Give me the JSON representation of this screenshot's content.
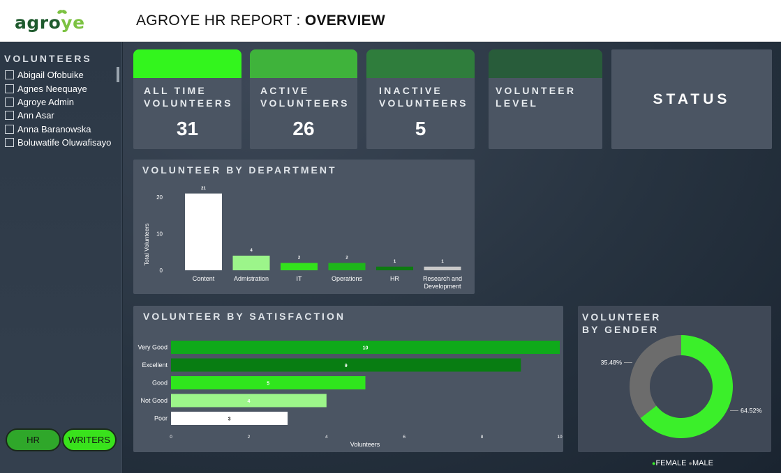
{
  "header": {
    "logo_main": "agro",
    "logo_accent": "ye",
    "title_prefix": "AGROYE HR REPORT : ",
    "title_bold": "OVERVIEW"
  },
  "sidebar": {
    "title": "VOLUNTEERS",
    "items": [
      {
        "label": "Abigail Ofobuike"
      },
      {
        "label": "Agnes Neequaye"
      },
      {
        "label": "Agroye Admin"
      },
      {
        "label": "Ann Asar"
      },
      {
        "label": "Anna Baranowska"
      },
      {
        "label": "Boluwatife Oluwafisayo"
      }
    ],
    "buttons": {
      "hr": "HR",
      "writers": "WRITERS"
    }
  },
  "kpis": {
    "all_time": {
      "line1": "ALL TIME",
      "line2": "VOLUNTEERS",
      "value": "31",
      "color": "#33f51d"
    },
    "active": {
      "line1": "ACTIVE",
      "line2": "VOLUNTEERS",
      "value": "26",
      "color": "#3fb33b"
    },
    "inactive": {
      "line1": "INACTIVE",
      "line2": "VOLUNTEERS",
      "value": "5",
      "color": "#2f7d3c"
    },
    "level": {
      "line1": "VOLUNTEER",
      "line2": "LEVEL",
      "color": "#285c3a"
    }
  },
  "status_label": "STATUS",
  "panels": {
    "department_title": "VOLUNTEER BY DEPARTMENT",
    "satisfaction_title": "VOLUNTEER BY SATISFACTION",
    "gender_title_line1": "VOLUNTEER",
    "gender_title_line2": "BY GENDER"
  },
  "legend": {
    "female": "FEMALE",
    "male": "MALE"
  },
  "chart_data": [
    {
      "type": "bar",
      "title": "VOLUNTEER BY DEPARTMENT",
      "ylabel": "Total Volunteers",
      "categories": [
        "Content",
        "Admistration",
        "IT",
        "Operations",
        "HR",
        "Research and Development"
      ],
      "values": [
        21,
        4,
        2,
        2,
        1,
        1
      ],
      "colors": [
        "#ffffff",
        "#9cf58a",
        "#33e21c",
        "#1eb61a",
        "#0e7a12",
        "#c9c9c9"
      ],
      "yticks": [
        0,
        10,
        20
      ],
      "ylim": [
        0,
        21
      ]
    },
    {
      "type": "bar",
      "orientation": "horizontal",
      "title": "VOLUNTEER BY SATISFACTION",
      "xlabel": "Volunteers",
      "categories": [
        "Very Good",
        "Excellent",
        "Good",
        "Not Good",
        "Poor"
      ],
      "values": [
        10,
        9,
        5,
        4,
        3
      ],
      "colors": [
        "#0faa1a",
        "#087d12",
        "#2fe61d",
        "#9cf58a",
        "#ffffff"
      ],
      "xticks": [
        0,
        2,
        4,
        6,
        8,
        10
      ],
      "xlim": [
        0,
        10
      ]
    },
    {
      "type": "pie",
      "title": "VOLUNTEER BY GENDER",
      "categories": [
        "FEMALE",
        "MALE"
      ],
      "values": [
        64.52,
        35.48
      ],
      "labels": [
        "64.52%",
        "35.48%"
      ],
      "colors": [
        "#3bef2a",
        "#6c6c6c"
      ]
    }
  ]
}
